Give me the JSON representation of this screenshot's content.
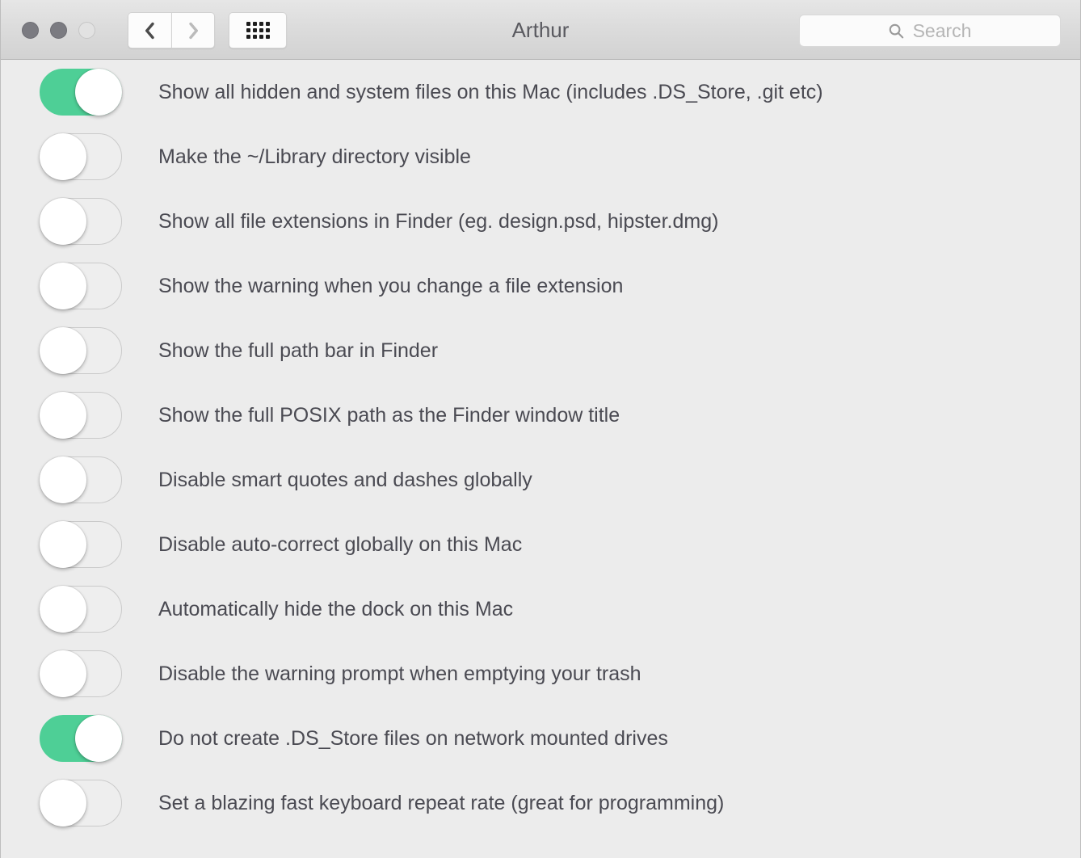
{
  "window": {
    "title": "Arthur",
    "traffic_lights": [
      {
        "name": "close-button",
        "state": "inactive-filled"
      },
      {
        "name": "minimize-button",
        "state": "inactive-filled"
      },
      {
        "name": "zoom-button",
        "state": "inactive-hollow"
      }
    ]
  },
  "toolbar": {
    "back_icon": "chevron-left-icon",
    "forward_icon": "chevron-right-icon",
    "back_enabled": true,
    "forward_enabled": false,
    "grid_icon": "grid-view-icon"
  },
  "search": {
    "icon": "search-icon",
    "placeholder": "Search",
    "value": ""
  },
  "colors": {
    "toggle_on": "#4ecf96",
    "toggle_off_border": "#cacaca",
    "content_background": "#ececec",
    "titlebar_background": "#dcdcdc",
    "label_text": "#4a4a52",
    "title_text": "#5a5a60",
    "placeholder_text": "#b5b5b5"
  },
  "preferences": [
    {
      "label": "Show all hidden and system files on this Mac (includes .DS_Store, .git etc)",
      "enabled": true
    },
    {
      "label": "Make the ~/Library directory visible",
      "enabled": false
    },
    {
      "label": "Show all file extensions in Finder (eg. design.psd, hipster.dmg)",
      "enabled": false
    },
    {
      "label": "Show the warning when you change a file extension",
      "enabled": false
    },
    {
      "label": "Show the full path bar in Finder",
      "enabled": false
    },
    {
      "label": "Show the full POSIX path as the Finder window title",
      "enabled": false
    },
    {
      "label": "Disable smart quotes and dashes globally",
      "enabled": false
    },
    {
      "label": "Disable auto-correct globally on this Mac",
      "enabled": false
    },
    {
      "label": "Automatically hide the dock on this Mac",
      "enabled": false
    },
    {
      "label": "Disable the warning prompt when emptying your trash",
      "enabled": false
    },
    {
      "label": "Do not create .DS_Store files on network mounted drives",
      "enabled": true
    },
    {
      "label": "Set a blazing fast keyboard repeat rate (great for programming)",
      "enabled": false
    }
  ]
}
